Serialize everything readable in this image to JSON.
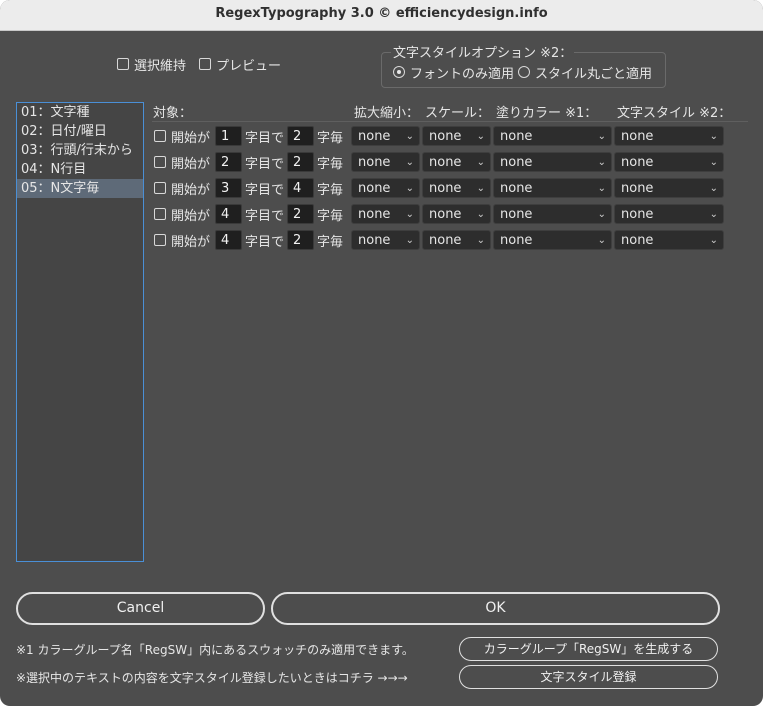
{
  "window": {
    "title": "RegexTypography 3.0 © efficiencydesign.info"
  },
  "options": {
    "keep_selection": "選択維持",
    "preview": "プレビュー"
  },
  "style_option": {
    "title": "文字スタイルオプション ※2：",
    "font_only": "フォントのみ適用",
    "whole_style": "スタイル丸ごと適用",
    "selected": "font_only"
  },
  "list": {
    "items": [
      "01：文字種",
      "02：日付/曜日",
      "03：行頭/行末から",
      "04：N行目",
      "05：N文字毎"
    ],
    "selected_index": 4
  },
  "headers": {
    "target": "対象：",
    "scale_tracking": "拡大縮小：",
    "scale": "スケール：",
    "fill_color": "塗りカラー ※1：",
    "char_style": "文字スタイル ※2："
  },
  "row_labels": {
    "start": "開始が",
    "char_at": "字目で",
    "every": "字毎"
  },
  "rows": [
    {
      "start": "1",
      "every": "2",
      "scaling": "none",
      "scale": "none",
      "color": "none",
      "style": "none"
    },
    {
      "start": "2",
      "every": "2",
      "scaling": "none",
      "scale": "none",
      "color": "none",
      "style": "none"
    },
    {
      "start": "3",
      "every": "4",
      "scaling": "none",
      "scale": "none",
      "color": "none",
      "style": "none"
    },
    {
      "start": "4",
      "every": "2",
      "scaling": "none",
      "scale": "none",
      "color": "none",
      "style": "none"
    },
    {
      "start": "4",
      "every": "2",
      "scaling": "none",
      "scale": "none",
      "color": "none",
      "style": "none"
    }
  ],
  "buttons": {
    "cancel": "Cancel",
    "ok": "OK",
    "create_color_group": "カラーグループ「RegSW」を生成する",
    "register_style": "文字スタイル登録"
  },
  "notes": {
    "note1": "※1 カラーグループ名「RegSW」内にあるスウォッチのみ適用できます。",
    "note2": "※選択中のテキストの内容を文字スタイル登録したいときはコチラ →→→"
  },
  "icons": {
    "dropdown": "chevron-down-icon"
  },
  "colors": {
    "background": "#4d4d4d",
    "list_border": "#4a8fd6",
    "field": "#1f1f1f"
  }
}
